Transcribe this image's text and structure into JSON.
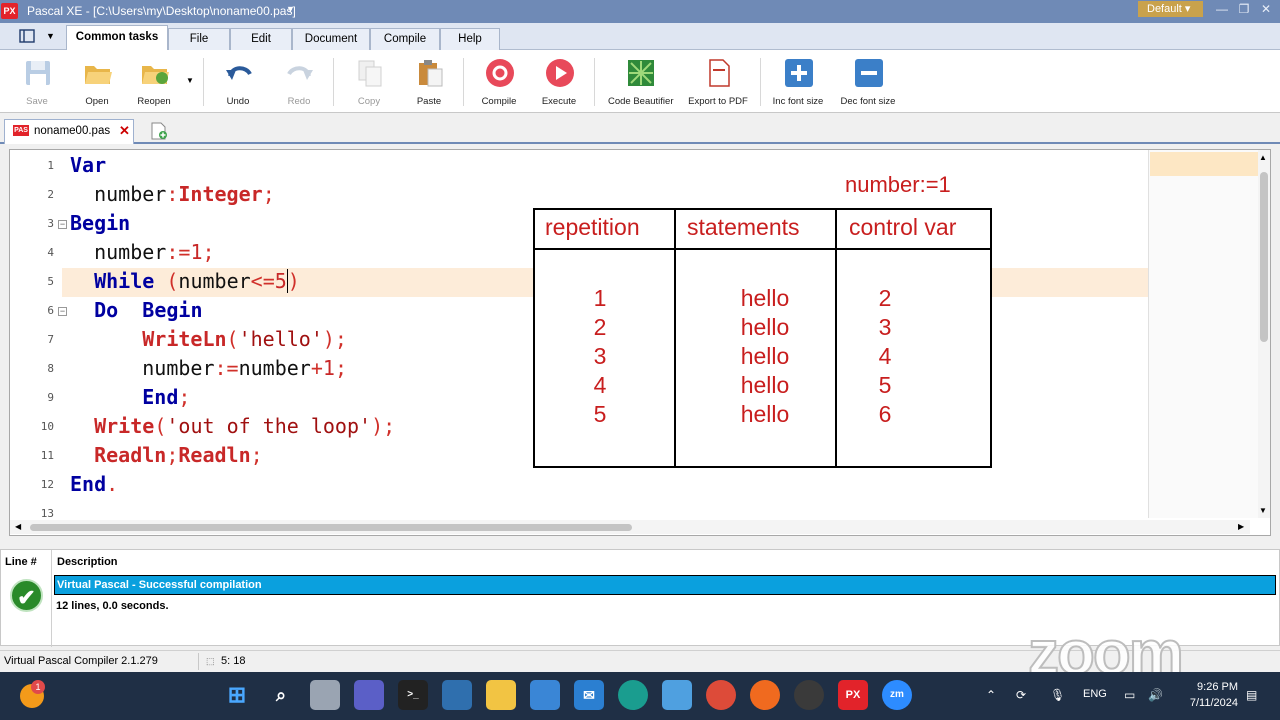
{
  "window": {
    "app_logo": "PX",
    "title": "Pascal XE - [C:\\Users\\my\\Desktop\\noname00.pas]",
    "theme": "Default",
    "controls": [
      "minimize-icon",
      "restore-icon",
      "close-icon"
    ]
  },
  "menu": {
    "tabs": [
      {
        "label": "Common tasks",
        "active": true
      },
      {
        "label": "File"
      },
      {
        "label": "Edit"
      },
      {
        "label": "Document"
      },
      {
        "label": "Compile"
      },
      {
        "label": "Help"
      }
    ]
  },
  "toolbar": {
    "buttons": [
      {
        "label": "Save",
        "icon": "floppy-icon",
        "disabled": true
      },
      {
        "label": "Open",
        "icon": "folder-open-icon"
      },
      {
        "label": "Reopen",
        "icon": "folder-reopen-icon"
      },
      {
        "label": "Undo",
        "icon": "undo-icon"
      },
      {
        "label": "Redo",
        "icon": "redo-icon",
        "disabled": true
      },
      {
        "label": "Copy",
        "icon": "copy-icon",
        "disabled": true
      },
      {
        "label": "Paste",
        "icon": "paste-icon"
      },
      {
        "label": "Compile",
        "icon": "compile-icon"
      },
      {
        "label": "Execute",
        "icon": "execute-icon"
      },
      {
        "label": "Code Beautifier",
        "icon": "beautifier-icon"
      },
      {
        "label": "Export to PDF",
        "icon": "pdf-icon"
      },
      {
        "label": "Inc font size",
        "icon": "plus-icon"
      },
      {
        "label": "Dec font size",
        "icon": "minus-icon"
      }
    ]
  },
  "document_tab": {
    "name": "noname00.pas",
    "badge": "PAS"
  },
  "editor": {
    "line_numbers": [
      "1",
      "2",
      "3",
      "4",
      "5",
      "6",
      "7",
      "8",
      "9",
      "10",
      "11",
      "12",
      "13"
    ],
    "code": {
      "l1_var": "Var",
      "l2_ident": "number",
      "l2_colon": ":",
      "l2_type": "Integer",
      "l2_semi": ";",
      "l3_begin": "Begin",
      "l4_ident": "number",
      "l4_op": ":=",
      "l4_num": "1",
      "l4_semi": ";",
      "l5_while": "While",
      "l5_open": " (",
      "l5_ident": "number",
      "l5_op": "<=",
      "l5_num": "5",
      "l5_close": ")",
      "l6_do": "Do",
      "l6_begin": "Begin",
      "l7_fn": "WriteLn",
      "l7_open": "(",
      "l7_str": "'hello'",
      "l7_close": ");",
      "l8_ident": "number",
      "l8_op": ":=",
      "l8_ident2": "number",
      "l8_plus": "+",
      "l8_num": "1",
      "l8_semi": ";",
      "l9_end": "End",
      "l9_semi": ";",
      "l10_fn": "Write",
      "l10_open": "(",
      "l10_str": "'out of the loop'",
      "l10_close": ");",
      "l11_fn1": "Readln",
      "l11_semi1": ";",
      "l11_fn2": "Readln",
      "l11_semi2": ";",
      "l12_end": "End",
      "l12_dot": "."
    },
    "current_line": 5
  },
  "annotation": {
    "initial_value": "number:=1",
    "headers": [
      "repetition",
      "statements",
      "control var"
    ],
    "rows": [
      [
        "1",
        "hello",
        "2"
      ],
      [
        "2",
        "hello",
        "3"
      ],
      [
        "3",
        "hello",
        "4"
      ],
      [
        "4",
        "hello",
        "5"
      ],
      [
        "5",
        "hello",
        "6"
      ]
    ]
  },
  "messages": {
    "col_line": "Line #",
    "col_description": "Description",
    "success": "Virtual Pascal - Successful compilation",
    "detail": "12 lines, 0.0 seconds."
  },
  "status": {
    "compiler": "Virtual Pascal Compiler 2.1.279",
    "position": "5: 18"
  },
  "watermark": "zoom",
  "taskbar": {
    "notification_badge": "1",
    "language": "ENG",
    "time": "9:26 PM",
    "date": "7/11/2024",
    "apps": [
      "start-icon",
      "search-icon",
      "task-view-icon",
      "teams-icon",
      "terminal-icon",
      "virtualbox-icon",
      "file-explorer-icon",
      "store-icon",
      "mail-icon",
      "edge-icon",
      "notepad-icon",
      "chrome-icon",
      "firefox-icon",
      "obs-icon",
      "pascal-xe-icon",
      "zoom-icon"
    ]
  }
}
